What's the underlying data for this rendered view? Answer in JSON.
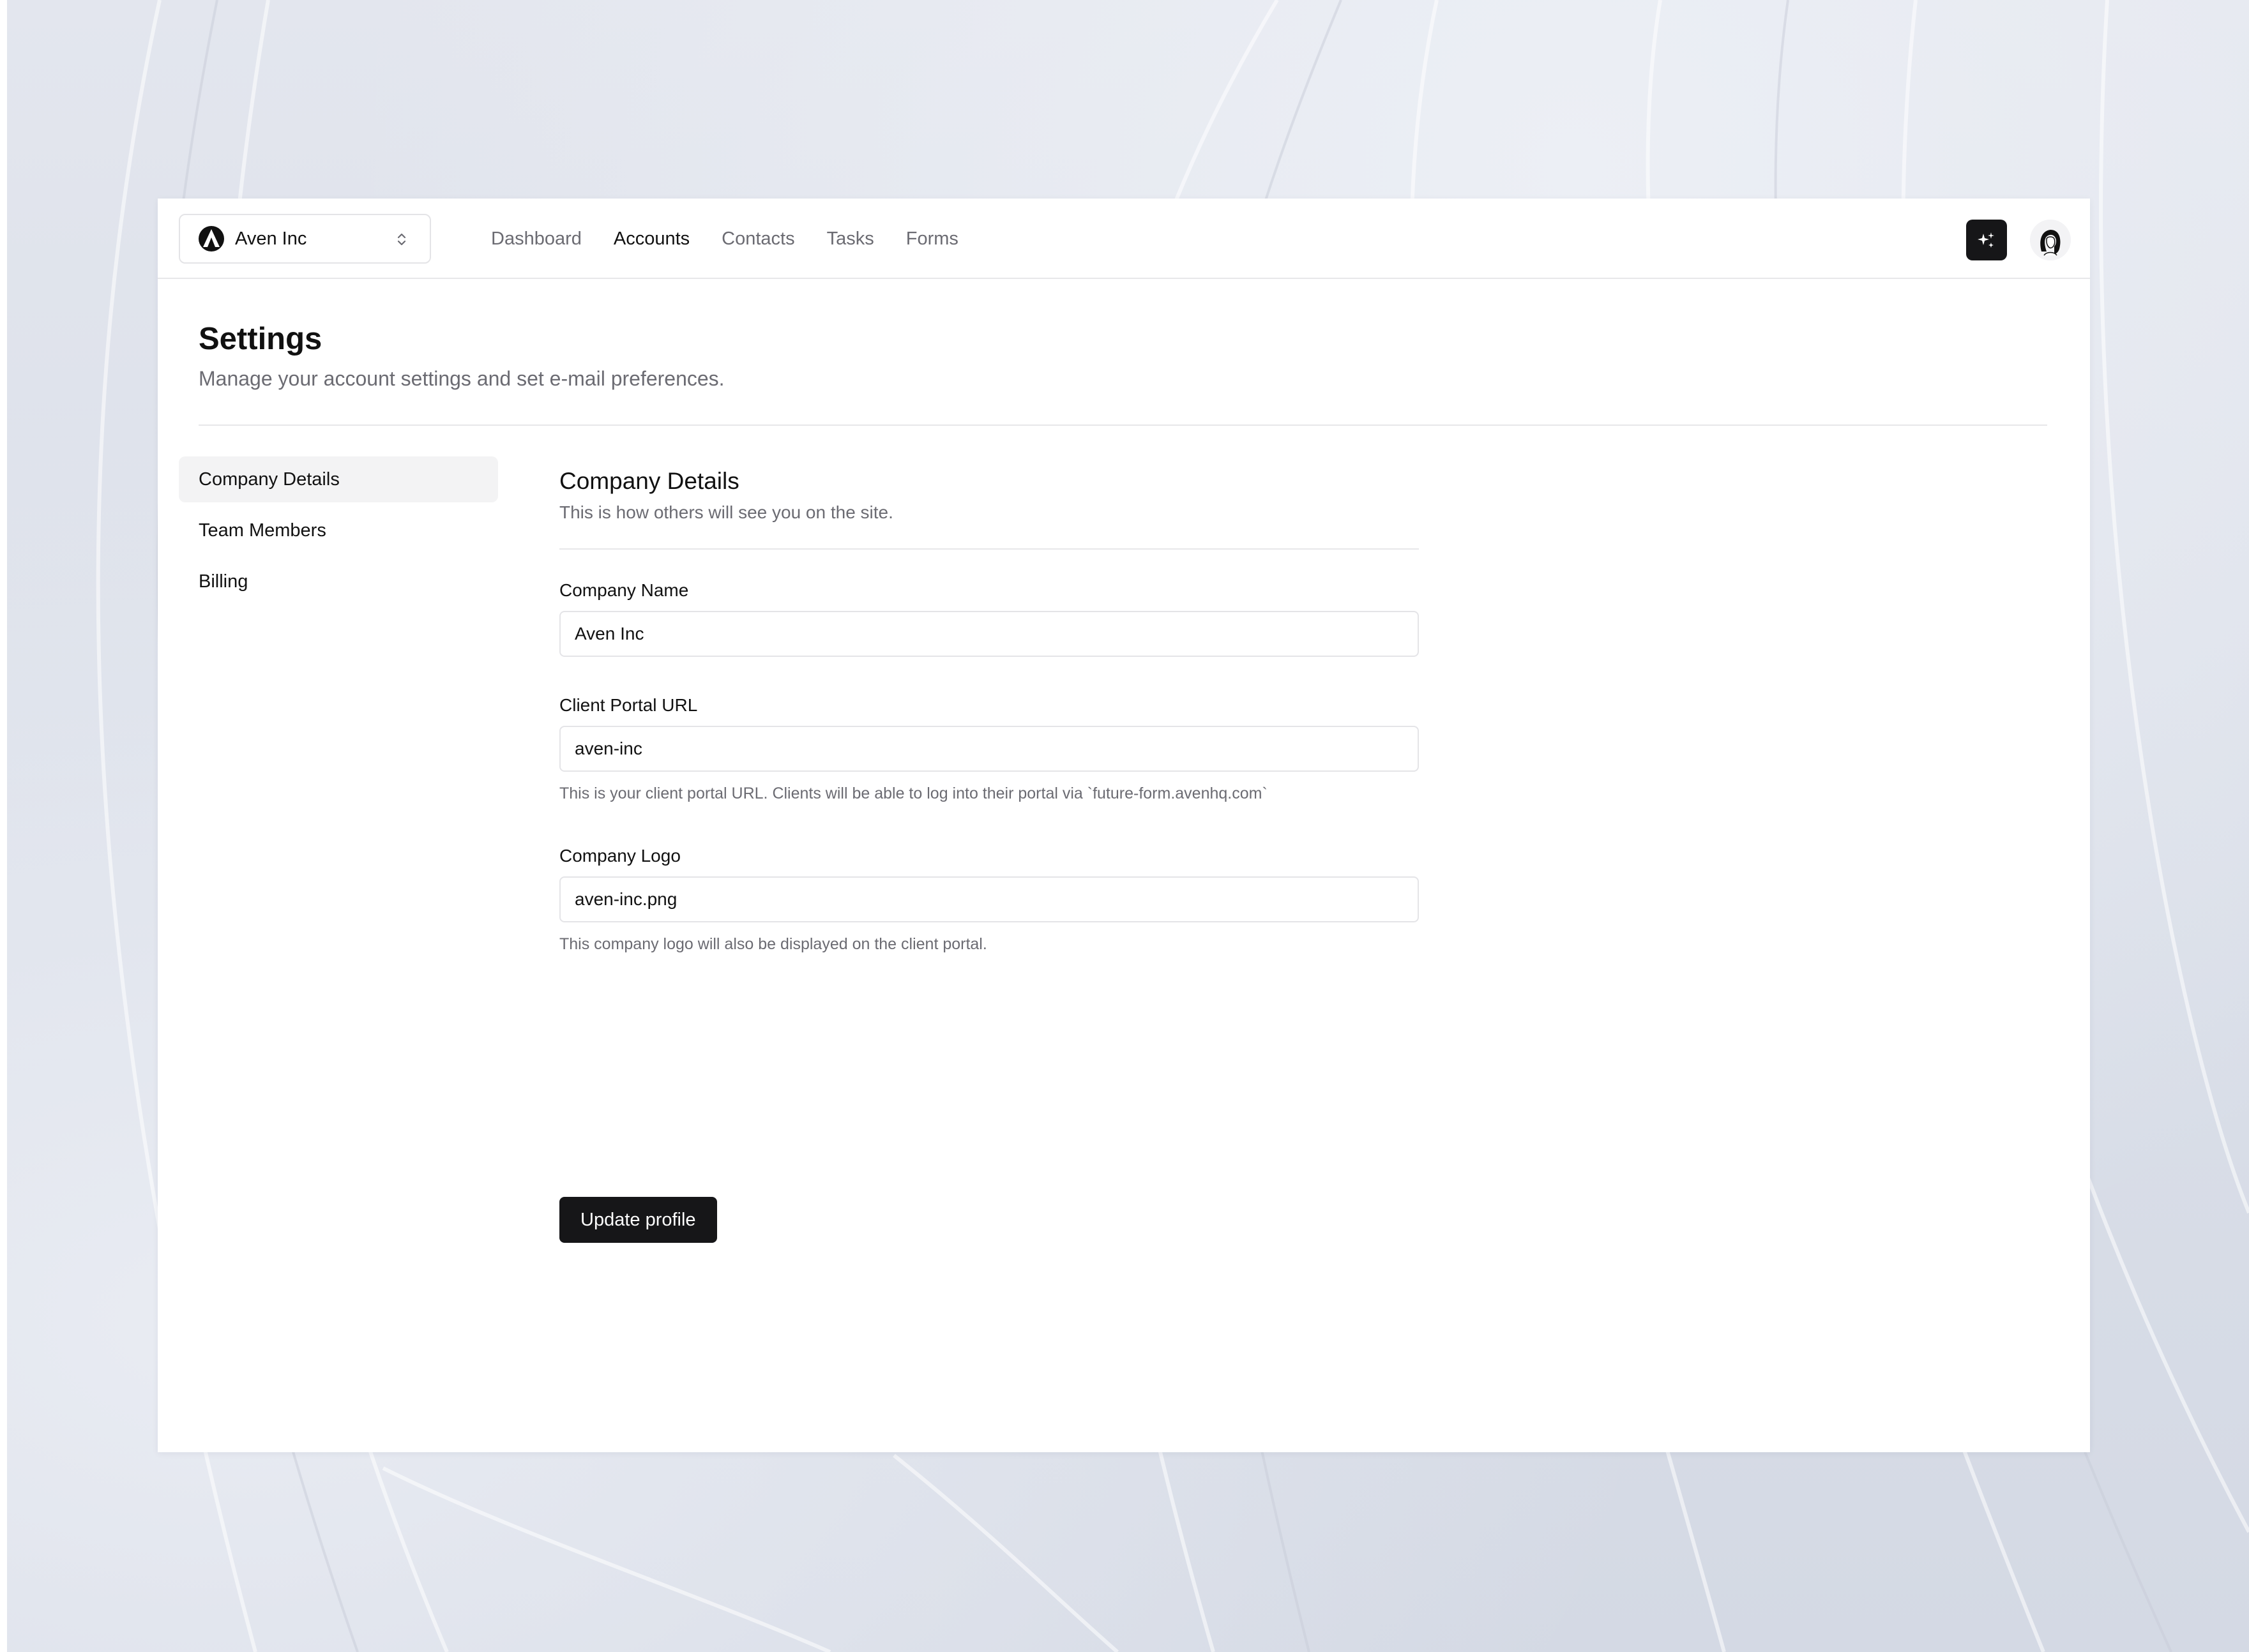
{
  "org_switcher": {
    "name": "Aven Inc"
  },
  "nav": {
    "items": [
      {
        "label": "Dashboard",
        "active": false
      },
      {
        "label": "Accounts",
        "active": true
      },
      {
        "label": "Contacts",
        "active": false
      },
      {
        "label": "Tasks",
        "active": false
      },
      {
        "label": "Forms",
        "active": false
      }
    ]
  },
  "header": {
    "title": "Settings",
    "subtitle": "Manage your account settings and set e-mail preferences."
  },
  "settings_nav": {
    "items": [
      {
        "label": "Company Details",
        "active": true
      },
      {
        "label": "Team Members",
        "active": false
      },
      {
        "label": "Billing",
        "active": false
      }
    ]
  },
  "section": {
    "title": "Company Details",
    "subtitle": "This is how others will see you on the site."
  },
  "form": {
    "company_name": {
      "label": "Company Name",
      "value": "Aven Inc"
    },
    "portal_url": {
      "label": "Client Portal URL",
      "value": "aven-inc",
      "help": "This is your client portal URL. Clients will be able to log into their portal via `future-form.avenhq.com`"
    },
    "logo": {
      "label": "Company Logo",
      "value": "aven-inc.png",
      "help": "This company logo will also be displayed on the client portal."
    },
    "submit_label": "Update profile"
  },
  "icons": {
    "org_logo": "aven-logo-icon",
    "org_chevron": "chevron-up-down-icon",
    "magic": "sparkles-icon",
    "avatar": "user-avatar"
  },
  "colors": {
    "accent": "#161618",
    "muted_text": "#6b6b72",
    "active_bg": "#f3f3f4",
    "border": "#e4e4e7"
  }
}
